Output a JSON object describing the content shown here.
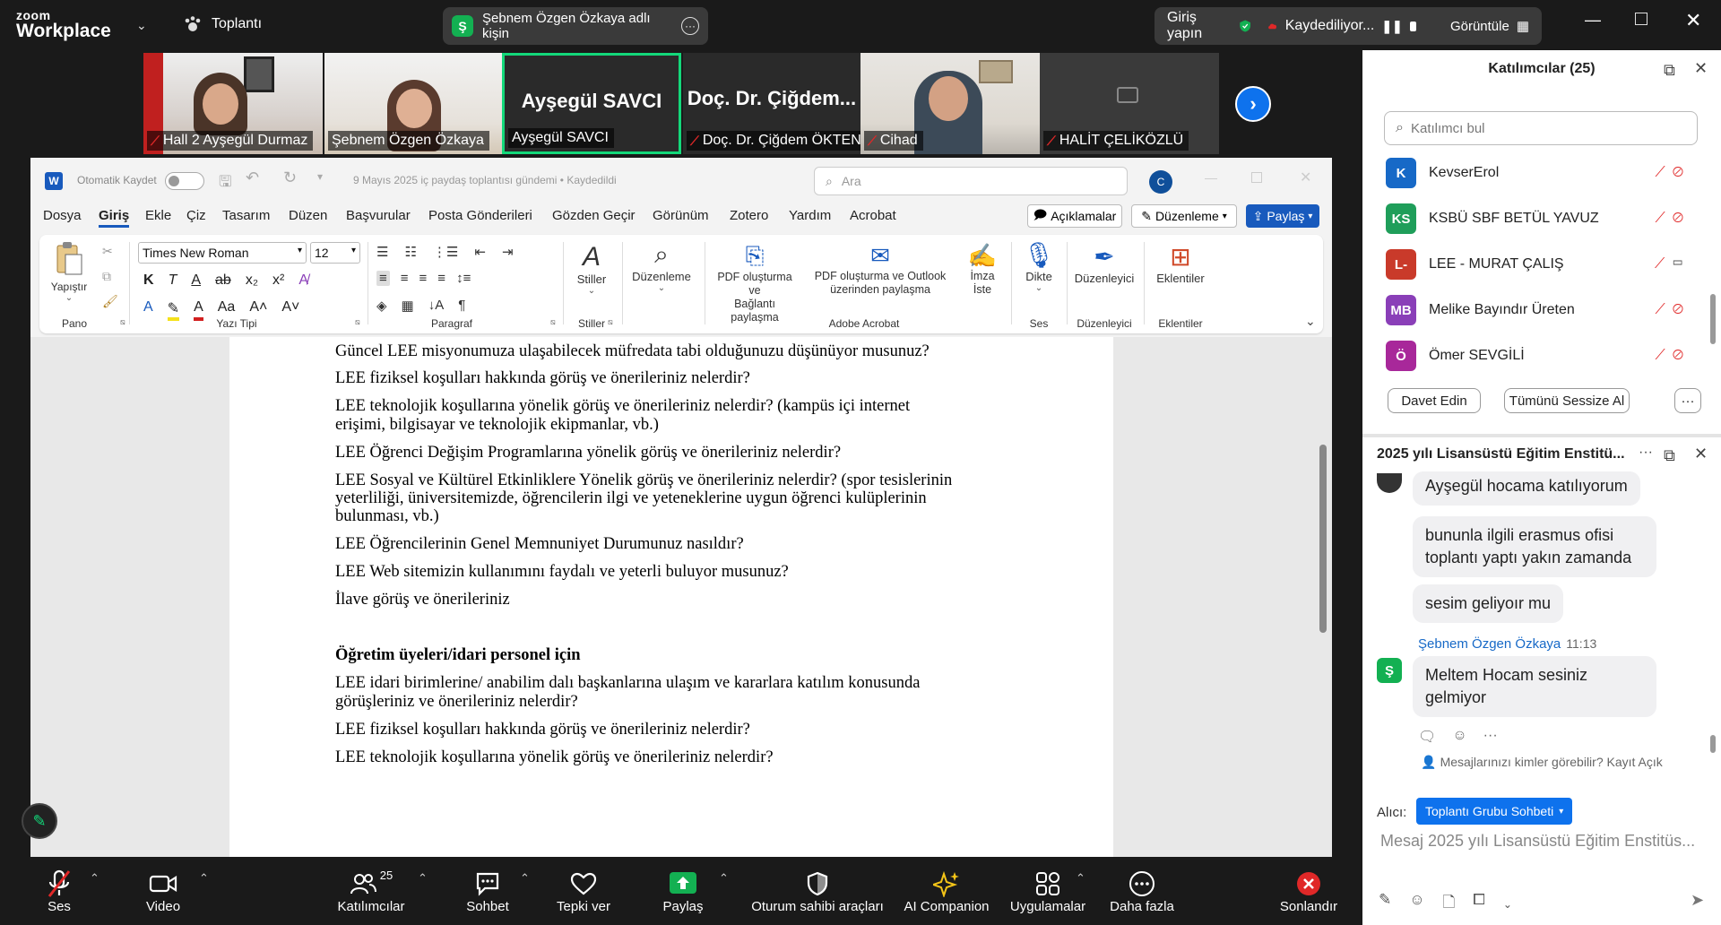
{
  "topbar": {
    "logo_line1": "zoom",
    "logo_line2": "Workplace",
    "meeting_label": "Toplantı",
    "speaker_initial": "Ş",
    "speaker_text": "Şebnem Özgen Özkaya adlı kişin",
    "signin": "Giriş yapın",
    "recording": "Kaydediliyor...",
    "view": "Görüntüle"
  },
  "participants_strip": [
    {
      "name": "Hall 2 Ayşegül Durmaz"
    },
    {
      "name": "Şebnem Özgen Özkaya"
    },
    {
      "name": "Ayşegül SAVCI",
      "big": "Ayşegül SAVCI"
    },
    {
      "name": "Doç. Dr. Çiğdem ÖKTEN",
      "big": "Doç. Dr. Çiğdem..."
    },
    {
      "name": "Cihad"
    },
    {
      "name": "HALİT ÇELİKÖZLÜ"
    }
  ],
  "word": {
    "autosave": "Otomatik Kaydet",
    "doc_title": "9 Mayıs 2025 iç paydaş toplantısı gündemi • Kaydedildi",
    "search_placeholder": "Ara",
    "user_initial": "C",
    "menu": [
      "Dosya",
      "Giriş",
      "Ekle",
      "Çiz",
      "Tasarım",
      "Düzen",
      "Başvurular",
      "Posta Gönderileri",
      "Gözden Geçir",
      "Görünüm",
      "Zotero",
      "Yardım",
      "Acrobat"
    ],
    "comments": "Açıklamalar",
    "editing": "Düzenleme",
    "share": "Paylaş",
    "ribbon": {
      "paste": "Yapıştır",
      "clipboard": "Pano",
      "font_name": "Times New Roman",
      "font_size": "12",
      "font_group": "Yazı Tipi",
      "paragraph": "Paragraf",
      "styles_btn": "Stiller",
      "styles_group": "Stiller",
      "editing_btn": "Düzenleme",
      "pdf1a": "PDF oluşturma ve",
      "pdf1b": "Bağlantı paylaşma",
      "pdf2a": "PDF oluşturma ve Outlook",
      "pdf2b": "üzerinden paylaşma",
      "sign_a": "İmza",
      "sign_b": "İste",
      "adobe": "Adobe Acrobat",
      "dictate": "Dikte",
      "voice": "Ses",
      "editor_btn": "Düzenleyici",
      "editor_group": "Düzenleyici",
      "addins_btn": "Eklentiler",
      "addins_group": "Eklentiler"
    },
    "lines": [
      "Güncel LEE misyonumuza ulaşabilecek müfredata tabi olduğunuzu düşünüyor musunuz?",
      "LEE fiziksel koşulları hakkında görüş ve önerileriniz nelerdir?",
      "LEE teknolojik koşullarına yönelik görüş ve önerileriniz nelerdir? (kampüs içi internet",
      "erişimi, bilgisayar ve teknolojik ekipmanlar, vb.)",
      "LEE Öğrenci Değişim Programlarına yönelik görüş ve önerileriniz nelerdir?",
      "LEE Sosyal ve Kültürel Etkinliklere Yönelik görüş ve önerileriniz nelerdir? (spor tesislerinin",
      "yeterliliği, üniversitemizde, öğrencilerin ilgi ve yeteneklerine uygun öğrenci kulüplerinin",
      "bulunması, vb.)",
      "LEE Öğrencilerinin Genel Memnuniyet Durumunuz nasıldır?",
      "LEE Web sitemizin kullanımını faydalı ve yeterli buluyor musunuz?",
      "İlave görüş ve önerileriniz",
      "Öğretim üyeleri/idari personel için",
      "LEE idari birimlerine/ anabilim dalı başkanlarına ulaşım ve kararlara katılım konusunda",
      "görüşleriniz ve önerileriniz nelerdir?",
      "LEE fiziksel koşulları hakkında görüş ve önerileriniz nelerdir?",
      "LEE teknolojik koşullarına yönelik görüş ve önerileriniz nelerdir?"
    ]
  },
  "toolbar": {
    "audio": "Ses",
    "video": "Video",
    "participants": "Katılımcılar",
    "participants_count": "25",
    "chat": "Sohbet",
    "react": "Tepki ver",
    "share": "Paylaş",
    "host_tools": "Oturum sahibi araçları",
    "ai": "AI Companion",
    "apps": "Uygulamalar",
    "more": "Daha fazla",
    "end": "Sonlandır"
  },
  "panel": {
    "title": "Katılımcılar (25)",
    "search_placeholder": "Katılımcı bul",
    "list": [
      {
        "initials": "K",
        "name": "KevserErol",
        "color": "#1769c7"
      },
      {
        "initials": "KS",
        "name": "KSBÜ SBF BETÜL YAVUZ",
        "color": "#1f9e5a"
      },
      {
        "initials": "L-",
        "name": "LEE - MURAT ÇALIŞ",
        "color": "#c93a2a"
      },
      {
        "initials": "MB",
        "name": "Melike Bayındır Üreten",
        "color": "#8a3fb8"
      },
      {
        "initials": "Ö",
        "name": "Ömer SEVGİLİ",
        "color": "#a8289a"
      }
    ],
    "invite": "Davet Edin",
    "mute_all": "Tümünü Sessize Al",
    "more": "···",
    "chat_title": "2025 yılı Lisansüstü Eğitim Enstitü...",
    "messages": [
      "Ayşegül hocama katılıyorum",
      "bununla ilgili erasmus ofisi toplantı yaptı yakın zamanda",
      "sesim geliyoır mu"
    ],
    "sender": "Şebnem Özgen Özkaya",
    "sender_time": "11:13",
    "sender_initial": "Ş",
    "last_message": "Meltem Hocam sesiniz gelmiyor",
    "visibility": "Mesajlarınızı kimler görebilir? Kayıt Açık",
    "to_label": "Alıcı:",
    "to_value": "Toplantı Grubu Sohbeti",
    "input_placeholder": "Mesaj 2025 yılı Lisansüstü Eğitim Enstitüs..."
  },
  "colors": {
    "zoom_blue": "#0e72ed",
    "share_green": "#13b052",
    "danger": "#e02828",
    "word_blue": "#185abd"
  }
}
